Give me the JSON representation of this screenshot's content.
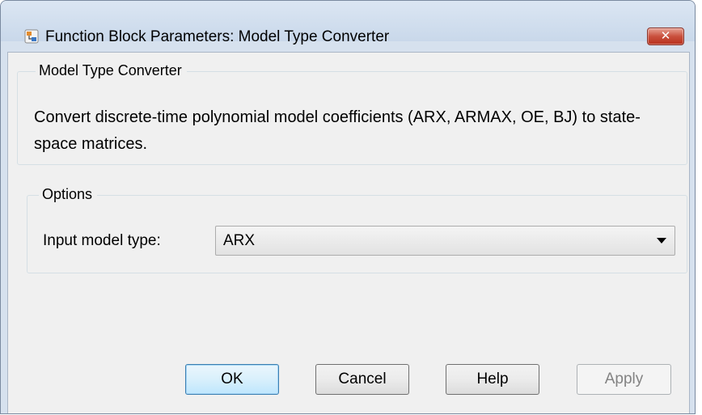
{
  "window": {
    "title": "Function Block Parameters: Model Type Converter",
    "app_icon": "simulink-block-icon",
    "close_label": "✕"
  },
  "block_panel": {
    "legend": "Model Type Converter",
    "description": "Convert discrete-time polynomial model coefficients (ARX, ARMAX, OE, BJ) to state-space matrices."
  },
  "options": {
    "legend": "Options",
    "input_model_type": {
      "label": "Input model type:",
      "selected": "ARX",
      "icon": "chevron-down-icon"
    }
  },
  "buttons": {
    "ok": "OK",
    "cancel": "Cancel",
    "help": "Help",
    "apply": "Apply"
  }
}
